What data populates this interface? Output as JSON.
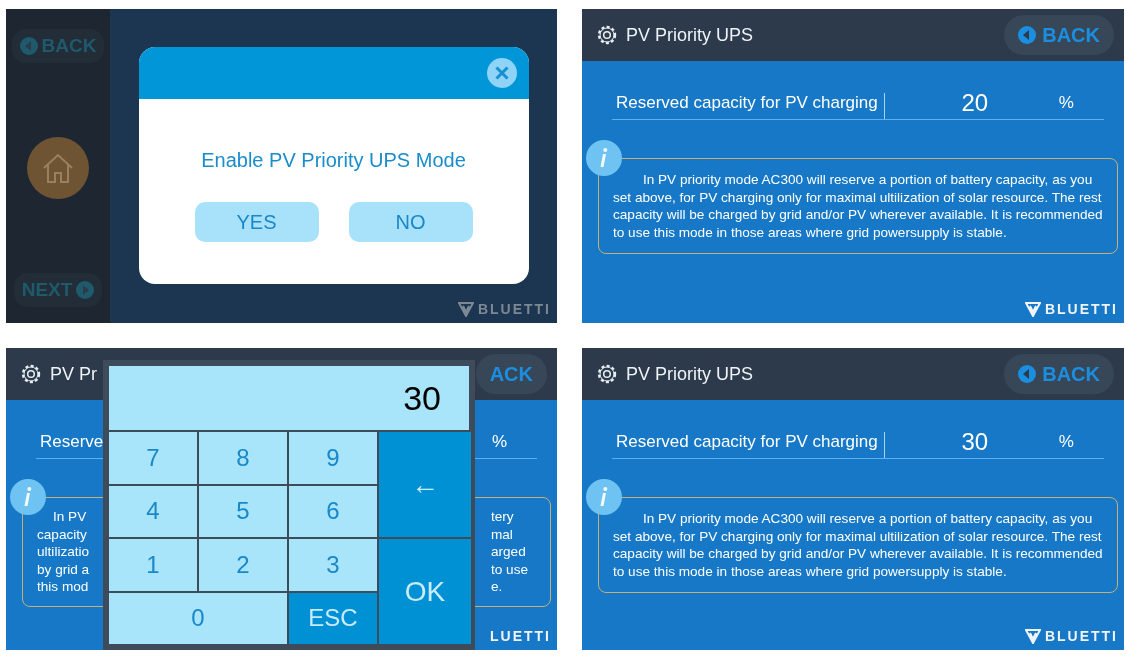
{
  "screen_rows": [
    [
      {
        "kind": "dialog",
        "sidebar": {
          "back": "BACK",
          "next": "NEXT"
        },
        "dialog": {
          "message": "Enable PV Priority UPS Mode",
          "buttons": [
            "YES",
            "NO"
          ]
        },
        "logo": "BLUETTI"
      },
      {
        "kind": "settings",
        "title": "PV Priority UPS",
        "back": "BACK",
        "setting": {
          "label": "Reserved capacity for PV charging",
          "value": "20",
          "unit": "%"
        },
        "info": "In PV priority mode AC300 will reserve a portion of battery capacity, as you set above, for PV charging only for maximal ultilization of solar resource. The rest capacity will be charged by grid and/or PV wherever available. It is recommended to use this mode in those areas where grid powersupply is stable.",
        "logo": "BLUETTI"
      }
    ],
    [
      {
        "kind": "keypad",
        "title": "PV Pr",
        "back": "ACK",
        "setting": {
          "label": "Reserve",
          "unit": "%"
        },
        "info_left": [
          "In PV",
          "capacity",
          "ultilizatio",
          "by grid a",
          "this mod"
        ],
        "info_right": [
          "tery",
          "mal",
          "arged",
          "to use",
          "e."
        ],
        "logo": "LUETTI",
        "keypad": {
          "display": "30",
          "keys": [
            {
              "label": "7",
              "kind": "digit"
            },
            {
              "label": "8",
              "kind": "digit"
            },
            {
              "label": "9",
              "kind": "digit"
            },
            {
              "label": "←",
              "kind": "tall"
            },
            {
              "label": "4",
              "kind": "digit"
            },
            {
              "label": "5",
              "kind": "digit"
            },
            {
              "label": "6",
              "kind": "digit"
            },
            {
              "label": "1",
              "kind": "digit"
            },
            {
              "label": "2",
              "kind": "digit"
            },
            {
              "label": "3",
              "kind": "digit"
            },
            {
              "label": "OK",
              "kind": "tall"
            },
            {
              "label": "0",
              "kind": "wide"
            },
            {
              "label": "ESC",
              "kind": "action"
            }
          ]
        }
      },
      {
        "kind": "settings",
        "title": "PV Priority UPS",
        "back": "BACK",
        "setting": {
          "label": "Reserved capacity for PV charging",
          "value": "30",
          "unit": "%"
        },
        "info": "In PV priority mode AC300 will reserve a portion of battery capacity, as you set above, for PV charging only for maximal ultilization of solar resource. The rest capacity will be charged by grid and/or PV wherever available. It is recommended to use this mode in those areas where grid powersupply is stable.",
        "logo": "BLUETTI"
      }
    ]
  ]
}
